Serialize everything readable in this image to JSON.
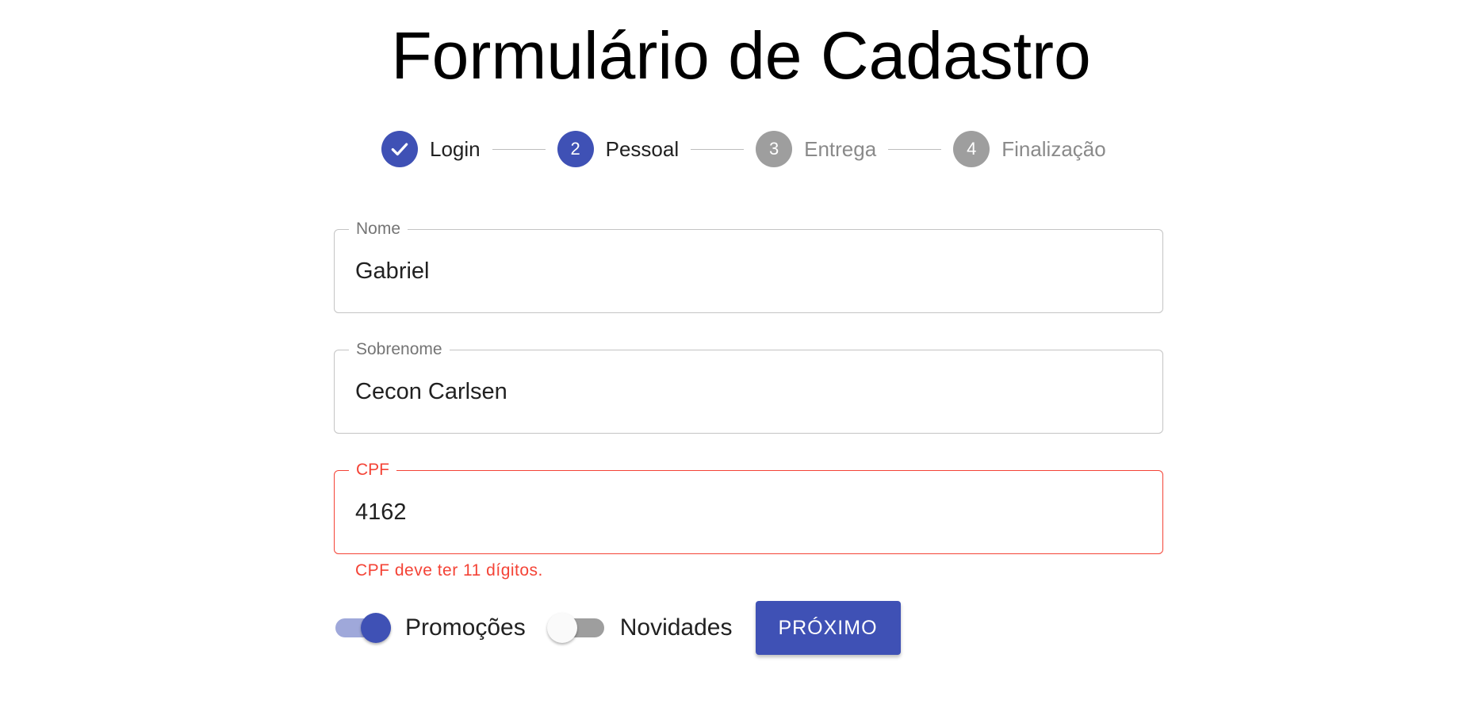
{
  "header": {
    "title": "Formulário de Cadastro"
  },
  "stepper": {
    "steps": [
      {
        "label": "Login",
        "number": "",
        "state": "completed",
        "icon": "check-icon"
      },
      {
        "label": "Pessoal",
        "number": "2",
        "state": "active"
      },
      {
        "label": "Entrega",
        "number": "3",
        "state": "inactive"
      },
      {
        "label": "Finalização",
        "number": "4",
        "state": "inactive"
      }
    ]
  },
  "form": {
    "nome": {
      "label": "Nome",
      "value": "Gabriel"
    },
    "sobrenome": {
      "label": "Sobrenome",
      "value": "Cecon Carlsen"
    },
    "cpf": {
      "label": "CPF",
      "value": "4162",
      "error": "CPF deve ter 11 dígitos."
    },
    "promocoes": {
      "label": "Promoções",
      "checked": true
    },
    "novidades": {
      "label": "Novidades",
      "checked": false
    },
    "next_label": "PRÓXIMO"
  },
  "colors": {
    "primary": "#3f51b5",
    "primary_light": "#9fa8da",
    "error": "#f44336",
    "inactive": "#9e9e9e"
  }
}
